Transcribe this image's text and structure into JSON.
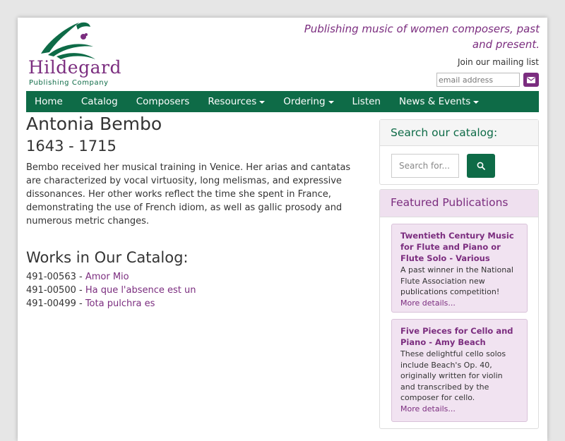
{
  "brand": {
    "logo_word": "Hildegard",
    "logo_sub": "Publishing Company",
    "tagline": "Publishing music of women composers, past and present."
  },
  "mailing": {
    "label": "Join our mailing list",
    "placeholder": "email address",
    "button_icon": "envelope-icon"
  },
  "nav": {
    "items": [
      {
        "label": "Home",
        "dropdown": false
      },
      {
        "label": "Catalog",
        "dropdown": false
      },
      {
        "label": "Composers",
        "dropdown": false
      },
      {
        "label": "Resources",
        "dropdown": true
      },
      {
        "label": "Ordering",
        "dropdown": true
      },
      {
        "label": "Listen",
        "dropdown": false
      },
      {
        "label": "News & Events",
        "dropdown": true
      }
    ]
  },
  "composer": {
    "name": "Antonia Bembo",
    "dates": "1643 - 1715",
    "bio": "Bembo received her musical training in Venice. Her arias and cantatas are characterized by vocal virtuosity, long melismas, and expressive dissonances. Her other works reflect the time she spent in France, demonstrating the use of French idiom, as well as gallic prosody and numerous metric changes."
  },
  "works": {
    "heading": "Works in Our Catalog:",
    "items": [
      {
        "number": "491-00563",
        "sep": " - ",
        "title": "Amor Mio"
      },
      {
        "number": "491-00500",
        "sep": " - ",
        "title": "Ha que l'absence est un"
      },
      {
        "number": "491-00499",
        "sep": " - ",
        "title": "Tota pulchra es"
      }
    ]
  },
  "sidebar": {
    "search": {
      "heading": "Search our catalog:",
      "placeholder": "Search for...",
      "button_icon": "search-icon"
    },
    "featured": {
      "heading": "Featured Publications",
      "items": [
        {
          "title": "Twentieth Century Music for Flute and Piano or Flute Solo - Various",
          "desc": "A past winner in the National Flute Association new publications competition!",
          "more": "More details..."
        },
        {
          "title": "Five Pieces for Cello and Piano - Amy Beach",
          "desc": "These delightful cello solos include Beach's Op. 40, originally written for violin and transcribed by the composer for cello.",
          "more": "More details..."
        }
      ]
    }
  },
  "colors": {
    "brand_purple": "#7b2d7f",
    "brand_green": "#0e6b47",
    "featured_bg": "#f1e3f1"
  }
}
